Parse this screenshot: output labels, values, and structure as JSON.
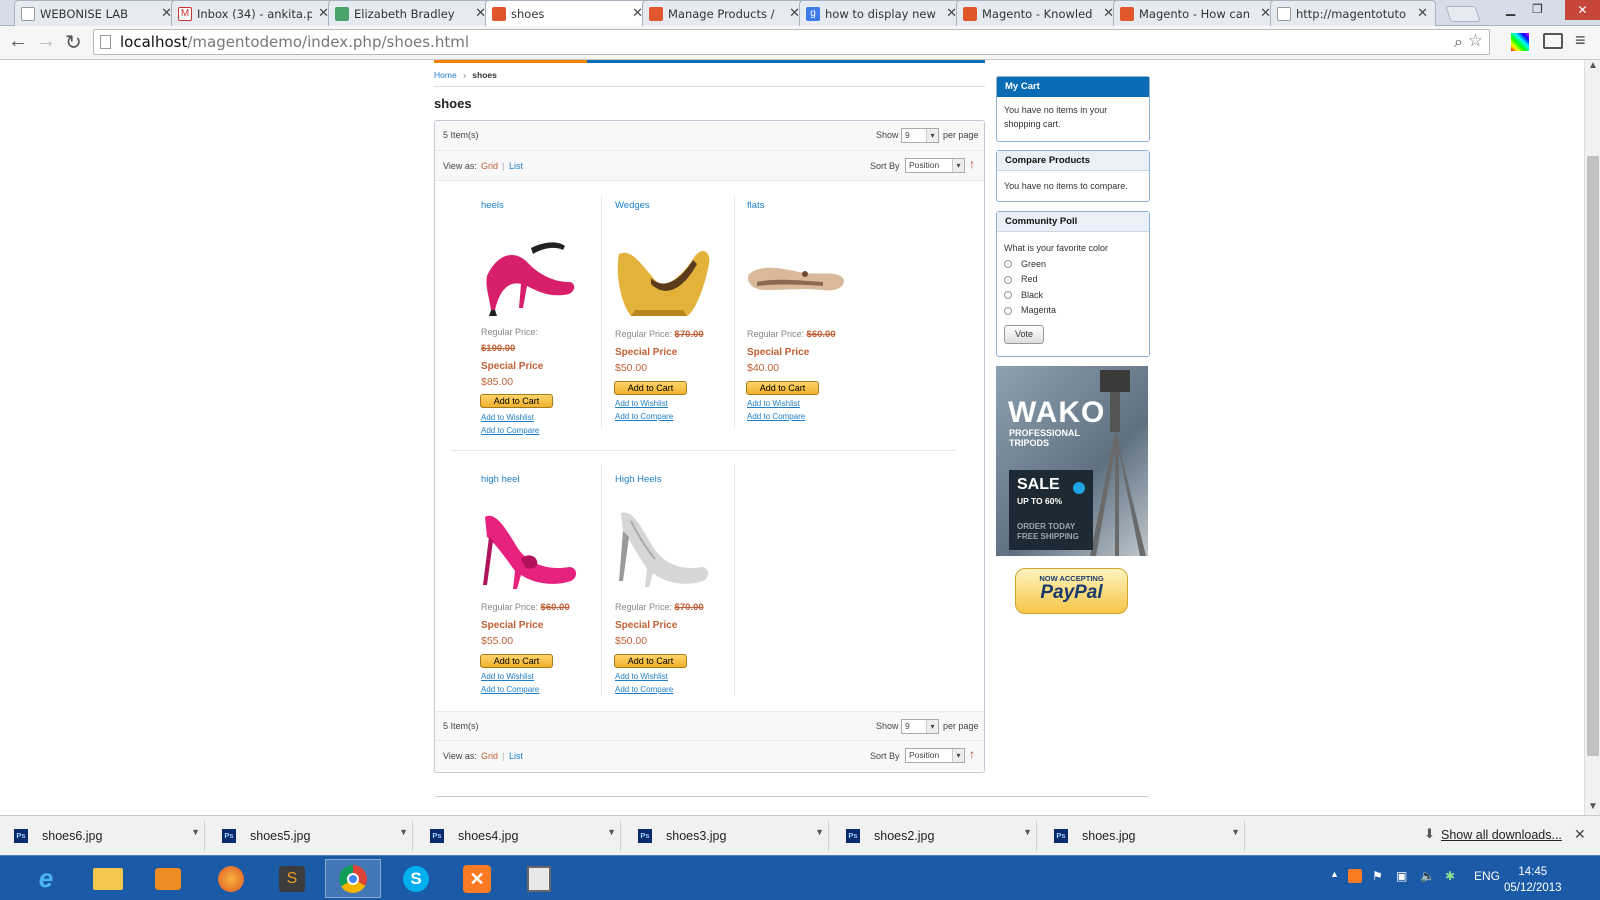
{
  "browser": {
    "tabs": [
      {
        "title": "WEBONISE LAB",
        "favicon": "page-icon"
      },
      {
        "title": "Inbox (34) - ankita.p",
        "favicon": "gmail-icon"
      },
      {
        "title": "Elizabeth Bradley",
        "favicon": "image-icon"
      },
      {
        "title": "shoes",
        "favicon": "magento-icon",
        "active": true
      },
      {
        "title": "Manage Products / ",
        "favicon": "magento-icon"
      },
      {
        "title": "how to display new",
        "favicon": "google-icon"
      },
      {
        "title": "Magento - Knowled",
        "favicon": "magento-icon"
      },
      {
        "title": "Magento - How can",
        "favicon": "magento-icon"
      },
      {
        "title": "http://magentotuto",
        "favicon": "page-icon"
      }
    ],
    "url_host": "localhost",
    "url_path": "/magentodemo/index.php/shoes.html"
  },
  "breadcrumb": {
    "home": "Home",
    "separator": "›",
    "current": "shoes"
  },
  "page_title": "shoes",
  "toolbar": {
    "items_count": "5 Item(s)",
    "show_label": "Show",
    "show_value": "9",
    "per_page": "per page",
    "view_as": "View as:",
    "grid": "Grid",
    "list": "List",
    "sort_by": "Sort By",
    "sort_value": "Position"
  },
  "products": [
    {
      "name": "heels",
      "regular_label": "Regular Price:",
      "regular_price": "$100.00",
      "special_label": "Special Price",
      "special_price": "$85.00",
      "color": "#d81f6a"
    },
    {
      "name": "Wedges",
      "regular_label": "Regular Price:",
      "regular_price": "$70.00",
      "special_label": "Special Price",
      "special_price": "$50.00",
      "color": "#e3b23a"
    },
    {
      "name": "flats",
      "regular_label": "Regular Price:",
      "regular_price": "$60.00",
      "special_label": "Special Price",
      "special_price": "$40.00",
      "color": "#d9b99a"
    },
    {
      "name": "high heel",
      "regular_label": "Regular Price:",
      "regular_price": "$60.00",
      "special_label": "Special Price",
      "special_price": "$55.00",
      "color": "#e6217e"
    },
    {
      "name": "High Heels",
      "regular_label": "Regular Price:",
      "regular_price": "$70.00",
      "special_label": "Special Price",
      "special_price": "$50.00",
      "color": "#cfcfcf"
    }
  ],
  "actions": {
    "add_to_cart": "Add to Cart",
    "add_to_wishlist": "Add to Wishlist",
    "add_to_compare": "Add to Compare"
  },
  "sidebar": {
    "cart": {
      "title": "My Cart",
      "body": "You have no items in your shopping cart."
    },
    "compare": {
      "title": "Compare Products",
      "body": "You have no items to compare."
    },
    "poll": {
      "title": "Community Poll",
      "question": "What is your favorite color",
      "options": [
        "Green",
        "Red",
        "Black",
        "Magenta"
      ],
      "vote": "Vote"
    },
    "ad": {
      "brand": "WAKO",
      "line1": "PROFESSIONAL",
      "line2": "TRIPODS",
      "sale": "SALE",
      "upto": "UP TO 60%",
      "order": "ORDER TODAY",
      "shipping": "FREE SHIPPING"
    },
    "paypal": {
      "top": "NOW ACCEPTING",
      "brand": "PayPal"
    }
  },
  "downloads": {
    "files": [
      "shoes6.jpg",
      "shoes5.jpg",
      "shoes4.jpg",
      "shoes3.jpg",
      "shoes2.jpg",
      "shoes.jpg"
    ],
    "show_all": "Show all downloads..."
  },
  "taskbar": {
    "lang": "ENG",
    "time": "14:45",
    "date": "05/12/2013"
  },
  "colors": {
    "accent": "#0a6bb5",
    "link": "#1e7ec8",
    "price": "#c06035",
    "taskbar": "#1b5aa6"
  }
}
